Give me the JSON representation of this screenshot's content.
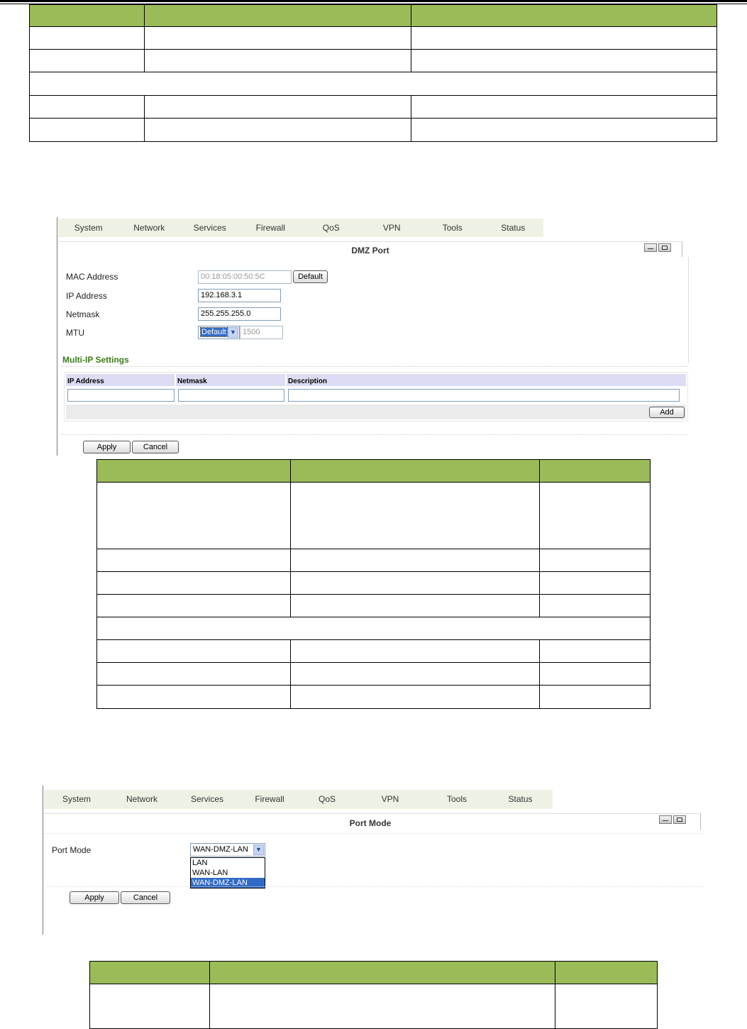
{
  "screenshot1": {
    "menu": [
      "System",
      "Network",
      "Services",
      "Firewall",
      "QoS",
      "VPN",
      "Tools",
      "Status"
    ],
    "panel_title": "DMZ Port",
    "fields": {
      "mac_label": "MAC Address",
      "mac_value": "00:18:05:00:50:5C",
      "default_button": "Default",
      "ip_label": "IP Address",
      "ip_value": "192.168.3.1",
      "netmask_label": "Netmask",
      "netmask_value": "255.255.255.0",
      "mtu_label": "MTU",
      "mtu_select": "Default",
      "mtu_value": "1500"
    },
    "multi_ip": {
      "heading": "Multi-IP Settings",
      "col_ip": "IP Address",
      "col_netmask": "Netmask",
      "col_description": "Description",
      "add_button": "Add"
    },
    "apply_button": "Apply",
    "cancel_button": "Cancel"
  },
  "screenshot2": {
    "menu": [
      "System",
      "Network",
      "Services",
      "Firewall",
      "QoS",
      "VPN",
      "Tools",
      "Status"
    ],
    "panel_title": "Port Mode",
    "port_mode_label": "Port Mode",
    "port_mode_selected": "WAN-DMZ-LAN",
    "options": [
      "LAN",
      "WAN-LAN",
      "WAN-DMZ-LAN"
    ],
    "apply_button": "Apply",
    "cancel_button": "Cancel"
  },
  "colors": {
    "table_header": "#9bbb59",
    "section_green": "#3a7d1a",
    "menubar": "#eef2e4",
    "selection_blue": "#316ac5"
  }
}
